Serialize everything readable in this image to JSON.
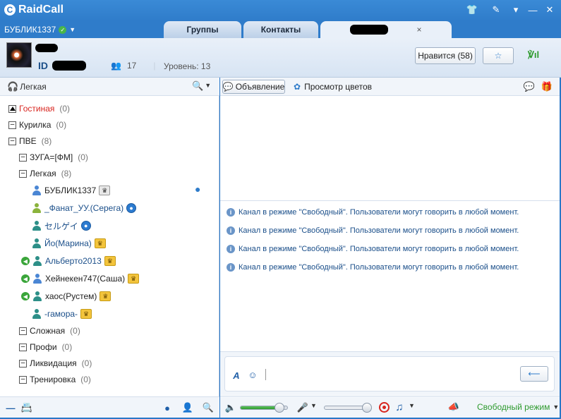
{
  "app": {
    "title": "RaidCall"
  },
  "colors": {
    "accent": "#2f7cca",
    "home_channel": "#d8251f",
    "message": "#1b4f8a",
    "mode": "#2e9a2e"
  },
  "user": {
    "name": "БУБЛИК1337"
  },
  "tabs": [
    {
      "label": "Группы"
    },
    {
      "label": "Контакты"
    },
    {
      "label": ""
    }
  ],
  "channel": {
    "id_label": "ID",
    "members": "17",
    "level": "Уровень: 13",
    "like_label": "Нравится (58)"
  },
  "left_toolbar": {
    "mode_label": "Легкая"
  },
  "tree": {
    "items": [
      {
        "label": "Гостиная",
        "count": "(0)"
      },
      {
        "label": "Курилка",
        "count": "(0)"
      },
      {
        "label": "ПВЕ",
        "count": "(8)"
      },
      {
        "label": "ЗУГА=[ФМ]",
        "count": "(0)"
      },
      {
        "label": "Легкая",
        "count": "(8)"
      },
      {
        "label": "Сложная",
        "count": "(0)"
      },
      {
        "label": "Профи",
        "count": "(0)"
      },
      {
        "label": "Ликвидация",
        "count": "(0)"
      },
      {
        "label": "Тренировка",
        "count": "(0)"
      }
    ],
    "users": [
      {
        "name": "БУБЛИК1337"
      },
      {
        "name": "_Фанат_УУ.(Серега)"
      },
      {
        "name": "セルゲイ"
      },
      {
        "name": "Йо(Марина)"
      },
      {
        "name": "Альберто2013"
      },
      {
        "name": "Хейнекен747(Саша)"
      },
      {
        "name": "хаос(Рустем)"
      },
      {
        "name": "-гамора-"
      }
    ]
  },
  "right_toolbar": {
    "announcement": "Объявление",
    "flowers": "Просмотр цветов"
  },
  "messages": [
    {
      "text": "Канал в режиме \"Свободный\". Пользователи могут говорить в любой момент."
    },
    {
      "text": "Канал в режиме \"Свободный\". Пользователи могут говорить в любой момент."
    },
    {
      "text": "Канал в режиме \"Свободный\". Пользователи могут говорить в любой момент."
    },
    {
      "text": "Канал в режиме \"Свободный\". Пользователи могут говорить в любой момент."
    }
  ],
  "audio": {
    "speaker_volume": 0.83,
    "mic_volume": 1.0,
    "mode_label": "Свободный режим"
  }
}
